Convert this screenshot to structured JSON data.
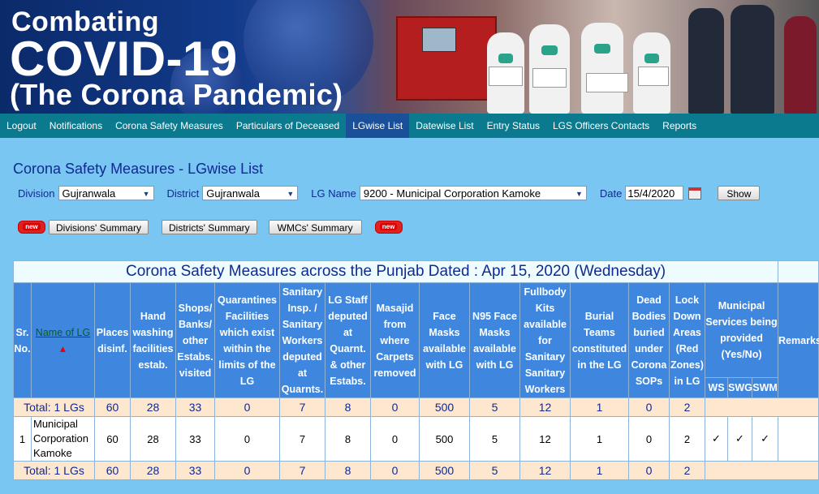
{
  "banner": {
    "line1": "Combating",
    "line2": "COVID-19",
    "line3": "(The Corona Pandemic)"
  },
  "nav": [
    {
      "label": "Logout"
    },
    {
      "label": "Notifications"
    },
    {
      "label": "Corona Safety Measures"
    },
    {
      "label": "Particulars of Deceased"
    },
    {
      "label": "LGwise List",
      "active": true
    },
    {
      "label": "Datewise List"
    },
    {
      "label": "Entry Status"
    },
    {
      "label": "LGS Officers Contacts"
    },
    {
      "label": "Reports"
    }
  ],
  "page_title": "Corona Safety Measures - LGwise List",
  "filters": {
    "division_label": "Division",
    "division_value": "Gujranwala",
    "district_label": "District",
    "district_value": "Gujranwala",
    "lg_label": "LG Name",
    "lg_value": "9200 - Municipal Corporation Kamoke",
    "date_label": "Date",
    "date_value": "15/4/2020",
    "show_button": "Show"
  },
  "summary_buttons": {
    "new_badge": "new",
    "divisions": "Divisions' Summary",
    "districts": "Districts' Summary",
    "wmcs": "WMCs' Summary"
  },
  "table": {
    "caption": "Corona Safety Measures across the Punjab Dated : Apr 15, 2020 (Wednesday)",
    "headers": {
      "sr": "Sr. No.",
      "name": "Name of LG",
      "places": "Places disinf.",
      "hand": "Hand washing facilities estab.",
      "shops": "Shops/ Banks/ other Estabs. visited",
      "quarantine": "Quarantines Facilities which exist within the limits of the LG",
      "sanitary": "Sanitary Insp. / Sanitary Workers deputed at Quarnts.",
      "lgstaff": "LG Staff deputed at Quarnt. & other Estabs.",
      "masajid": "Masajid from where Carpets removed",
      "face": "Face Masks available with LG",
      "n95": "N95 Face Masks available with LG",
      "fullbody": "Fullbody Kits available for Sanitary Sanitary Workers",
      "burial": "Burial Teams constituted in the LG",
      "dead": "Dead Bodies buried under Corona SOPs",
      "lockdown": "Lock Down Areas (Red Zones) in LG",
      "municipal": "Municipal Services being provided (Yes/No)",
      "ws": "WS",
      "swg": "SWG",
      "swm": "SWM",
      "remarks": "Remarks"
    },
    "total_label": "Total: 1 LGs",
    "totals": [
      "60",
      "28",
      "33",
      "0",
      "7",
      "8",
      "0",
      "500",
      "5",
      "12",
      "1",
      "0",
      "2"
    ],
    "rows": [
      {
        "sr": "1",
        "name": "Municipal Corporation Kamoke",
        "values": [
          "60",
          "28",
          "33",
          "0",
          "7",
          "8",
          "0",
          "500",
          "5",
          "12",
          "1",
          "0",
          "2"
        ],
        "ws": "✓",
        "swg": "✓",
        "swm": "✓",
        "remarks": ""
      }
    ]
  }
}
